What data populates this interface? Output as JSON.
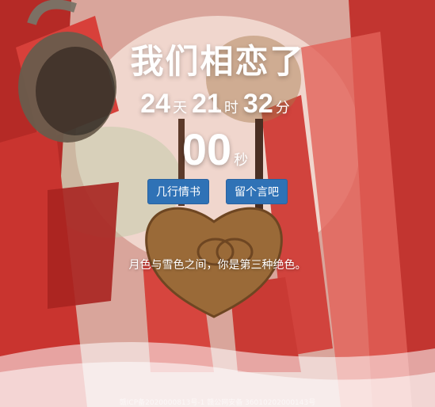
{
  "main": {
    "title": "我们相恋了",
    "timer": {
      "days": "24",
      "days_unit": "天",
      "hours": "21",
      "hours_unit": "时",
      "minutes": "32",
      "minutes_unit": "分",
      "seconds": "00",
      "seconds_unit": "秒"
    },
    "buttons": {
      "letter": "几行情书",
      "message": "留个言吧"
    },
    "quote": "月色与雪色之间，你是第三种绝色。"
  },
  "footer": {
    "text": "赣ICP备2020000813号-1 赣公网安备 36010202000143号"
  },
  "colors": {
    "button": "#2f72b6",
    "ribbon": "#c4352f",
    "lock": "#9a6a38"
  }
}
